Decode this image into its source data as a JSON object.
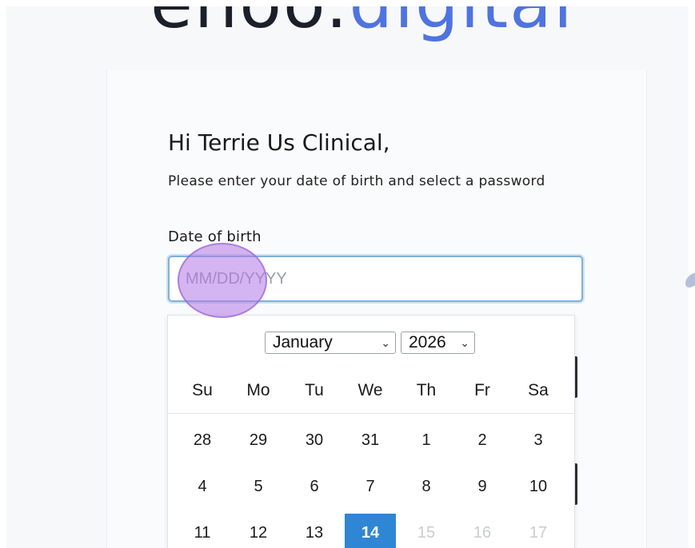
{
  "logo": {
    "dark_text": "enoo.",
    "light_text": "digital"
  },
  "greeting": "Hi Terrie Us Clinical,",
  "instructions": "Please enter your date of birth and select a password",
  "dob": {
    "label": "Date of birth",
    "placeholder": "MM/DD/YYYY",
    "value": ""
  },
  "calendar": {
    "month": "January",
    "year": "2026",
    "weekdays": [
      "Su",
      "Mo",
      "Tu",
      "We",
      "Th",
      "Fr",
      "Sa"
    ],
    "weeks": [
      [
        "28",
        "29",
        "30",
        "31",
        "1",
        "2",
        "3"
      ],
      [
        "4",
        "5",
        "6",
        "7",
        "8",
        "9",
        "10"
      ],
      [
        "11",
        "12",
        "13",
        "14",
        "15",
        "16",
        "17"
      ]
    ],
    "selected_day": "14",
    "disabled_days": [
      "15",
      "16",
      "17"
    ]
  },
  "colors": {
    "logo_dark": "#1b1f2a",
    "logo_accent": "#4f73e0",
    "input_focus_border": "#7fb1d8",
    "selected_day_bg": "#2f86d4",
    "cursor_highlight": "#b078e6"
  }
}
